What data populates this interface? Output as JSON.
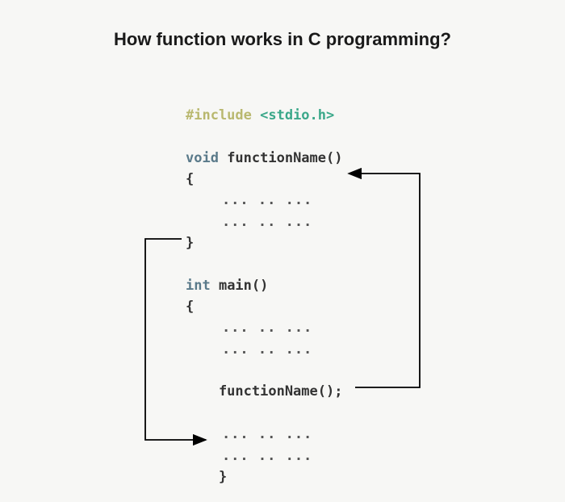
{
  "title": "How function works in C programming?",
  "code": {
    "include_kw": "#include ",
    "include_header": "<stdio.h>",
    "void_kw": "void",
    "func_decl_name": " functionName()",
    "open_brace": "{",
    "close_brace": "}",
    "dots_indent": "    ... .. ...",
    "int_kw": "int",
    "main_name": " main()",
    "call_line": "    functionName();",
    "close_brace_indent": "    }",
    "dots_indent2": "    ... .. ..."
  }
}
